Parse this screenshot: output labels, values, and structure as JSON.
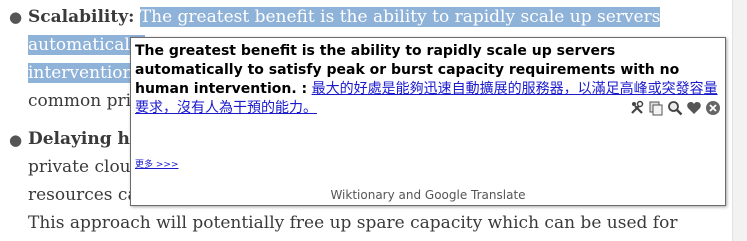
{
  "article": {
    "item1_label": "Scalability:",
    "item1_line1_highlighted": "The greatest benefit is the ability to rapidly scale up servers",
    "item1_line2_highlighted": "automatically",
    "item2_line3": "intervention",
    "item1_line4": "common priv",
    "item2_label": "Delaying ha",
    "item2_line2": "private cloud",
    "item2_line3b": "resources car",
    "item2_line4": "This approach will potentially free up spare capacity which can be used for"
  },
  "popup": {
    "source_text": "The greatest benefit is the ability to rapidly scale up servers automatically to satisfy peak or burst capacity requirements with no human intervention. :",
    "translation": "最大的好處是能夠迅速自動擴展的服務器，以滿足高峰或突發容量要求，沒有人為干預的能力。",
    "more_link": "更多 >>>",
    "footer": "Wiktionary and Google Translate",
    "toolbar_icons": [
      "tools-icon",
      "copy-icon",
      "magnifier-icon",
      "heart-icon",
      "close-icon"
    ]
  },
  "colors": {
    "highlight": "#8fb2d9",
    "link": "#1a1acc"
  }
}
